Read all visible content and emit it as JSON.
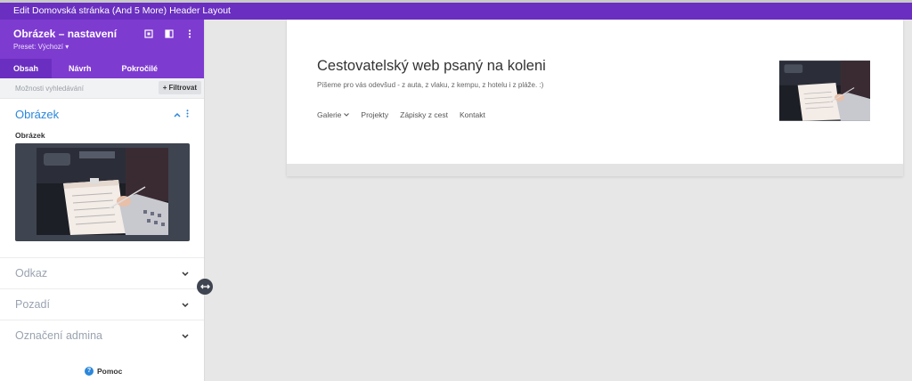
{
  "window": {
    "title": "Edit Domovská stránka (And 5 More) Header Layout"
  },
  "panel": {
    "title": "Obrázek – nastavení",
    "preset": "Preset: Výchozí ▾",
    "tabs": [
      {
        "label": "Obsah",
        "active": true
      },
      {
        "label": "Návrh",
        "active": false
      },
      {
        "label": "Pokročilé",
        "active": false
      }
    ],
    "search_placeholder": "Možnosti vyhledávání",
    "filter_label": "Filtrovat",
    "open_section": {
      "title": "Obrázek",
      "field_label": "Obrázek"
    },
    "sections": [
      "Odkaz",
      "Pozadí",
      "Označení admina"
    ],
    "help_label": "Pomoc"
  },
  "site": {
    "title": "Cestovatelský web psaný na koleni",
    "tagline": "Píšeme pro vás odevšud - z auta, z vlaku, z kempu, z hotelu i z pláže. :)",
    "nav": [
      "Galerie",
      "Projekty",
      "Zápisky z cest",
      "Kontakt"
    ]
  },
  "colors": {
    "title_bar": "#6a2fc0",
    "panel_header": "#7e3bd0",
    "accent_blue": "#2b87da"
  }
}
